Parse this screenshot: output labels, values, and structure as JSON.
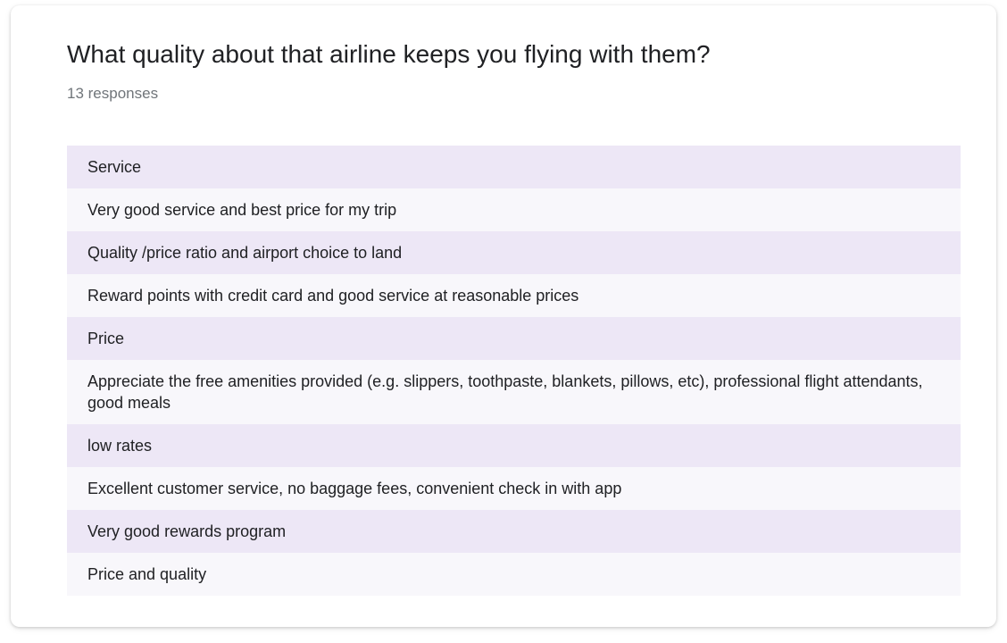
{
  "question": {
    "title": "What quality about that airline keeps you flying with them?",
    "responses_label": "13 responses"
  },
  "responses": [
    "Service",
    "Very good service and best price for my trip",
    "Quality /price ratio and airport choice to land",
    "Reward points with credit card and good service at reasonable prices",
    "Price",
    "Appreciate the free amenities provided (e.g. slippers, toothpaste, blankets, pillows, etc), professional flight attendants, good meals",
    "low rates",
    "Excellent customer service, no baggage fees, convenient check in with app",
    "Very good rewards program",
    "Price and quality"
  ],
  "colors": {
    "row_odd": "#ede7f6",
    "row_even": "#f8f7fb",
    "text": "#202124",
    "muted": "#70757a"
  }
}
